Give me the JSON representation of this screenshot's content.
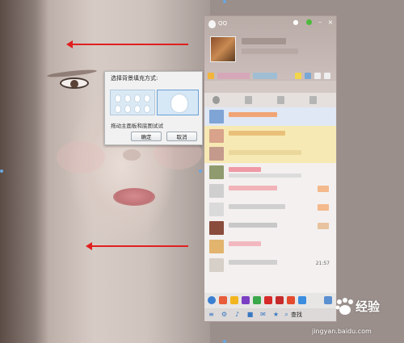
{
  "dialog": {
    "title": "选择背景填充方式:",
    "hint": "拖动主面板和底图试试",
    "ok_label": "确定",
    "cancel_label": "取消",
    "options": [
      "tile-repeat",
      "stretch-fill"
    ],
    "selected_option": "stretch-fill"
  },
  "qq_panel": {
    "title": "QQ",
    "list_time": "21:57",
    "find_label": "查找",
    "colors": {
      "accent": "#3a78c2",
      "highlight_row": "#f7e9b3",
      "status_online": "#4cba3c"
    }
  },
  "annotations": {
    "arrow_color": "#e02020"
  },
  "watermark": {
    "brand": "Bai",
    "brand_suffix": "经验",
    "url": "jingyan.baidu.com"
  }
}
